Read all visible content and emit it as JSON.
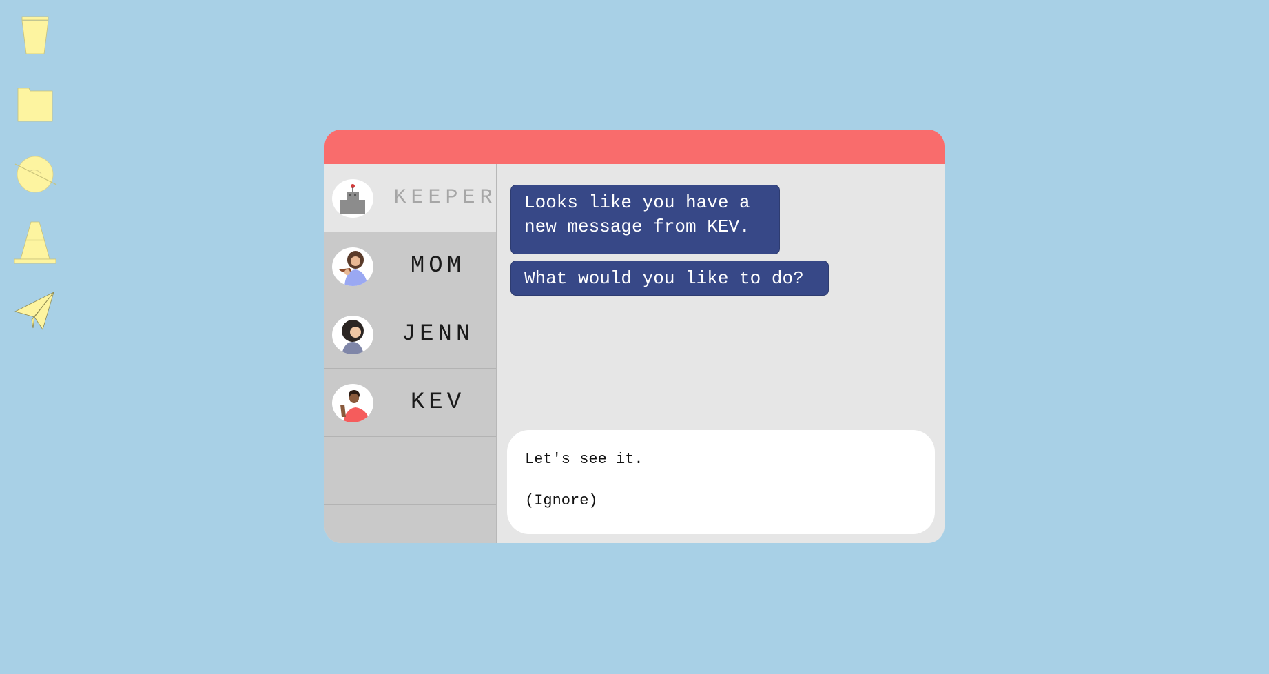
{
  "desktop": {
    "icons": [
      {
        "name": "trash-icon"
      },
      {
        "name": "folder-icon"
      },
      {
        "name": "browser-globe-icon"
      },
      {
        "name": "traffic-cone-icon"
      },
      {
        "name": "paper-plane-icon"
      }
    ],
    "icon_color": "#fdf4a0"
  },
  "window": {
    "titlebar_color": "#f96c6c"
  },
  "sidebar": {
    "contacts": [
      {
        "label": "KEEPER",
        "avatar": "robot-avatar",
        "active": true
      },
      {
        "label": "MOM",
        "avatar": "mom-avatar",
        "active": false
      },
      {
        "label": "JENN",
        "avatar": "jenn-avatar",
        "active": false
      },
      {
        "label": "KEV",
        "avatar": "kev-avatar",
        "active": false
      }
    ]
  },
  "chat": {
    "messages": [
      "Looks like you have a\nnew message from KEV.",
      "What would you like to do?"
    ],
    "bubble_color": "#374887",
    "reply_options": [
      "Let's see it.",
      "(Ignore)"
    ]
  }
}
